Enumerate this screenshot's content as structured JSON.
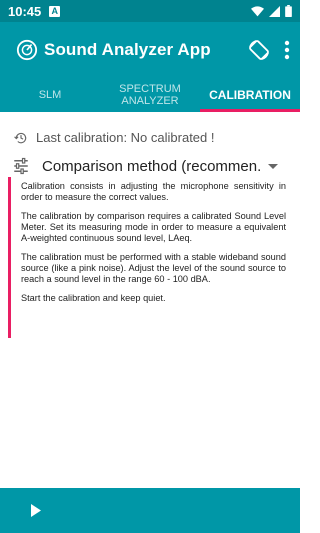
{
  "status_bar": {
    "time": "10:45",
    "notification_letter": "A"
  },
  "app_bar": {
    "title": "Sound Analyzer App",
    "logo_icon": "sound-analyzer-logo",
    "rotate_icon": "screen-rotation",
    "more_icon": "more-vert"
  },
  "tabs": [
    {
      "label": "SLM",
      "active": false
    },
    {
      "label": "SPECTRUM\nANALYZER",
      "active": false
    },
    {
      "label": "CALIBRATION",
      "active": true
    }
  ],
  "last_calibration": {
    "text": "Last calibration: No calibrated !",
    "icon": "history-clock"
  },
  "method": {
    "value": "Comparison method (recommen..",
    "icon": "tune-sliders"
  },
  "info": {
    "p1": "Calibration consists in adjusting the microphone sensitivity in order to measure the correct values.",
    "p2": "The calibration by comparison requires a calibrated Sound Level Meter. Set its measuring mode in order to measure a equivalent A-weighted continuous sound level, LAeq.",
    "p3": "The calibration must be performed with a stable wideband sound source (like a pink noise). Adjust the level of the sound source to reach a sound level in the range 60 - 100 dBA.",
    "p4": "Start the calibration and keep quiet."
  },
  "bottom_bar": {
    "play_icon": "play"
  },
  "colors": {
    "primary": "#0097a7",
    "primary_dark": "#00838f",
    "accent": "#e91e63"
  }
}
